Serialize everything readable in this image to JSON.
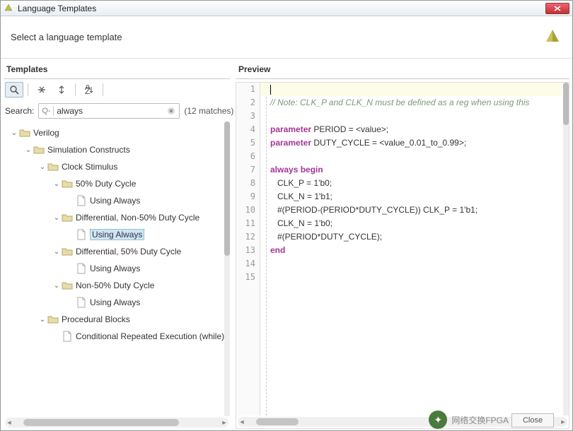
{
  "window": {
    "title": "Language Templates"
  },
  "subheader": {
    "text": "Select a language template"
  },
  "panes": {
    "templates_title": "Templates",
    "preview_title": "Preview"
  },
  "search": {
    "label": "Search:",
    "q_prefix": "Q-",
    "value": "always",
    "matches": "(12 matches)"
  },
  "tree": [
    {
      "indent": 0,
      "expanded": true,
      "kind": "folder",
      "label": "Verilog"
    },
    {
      "indent": 1,
      "expanded": true,
      "kind": "folder",
      "label": "Simulation Constructs"
    },
    {
      "indent": 2,
      "expanded": true,
      "kind": "folder",
      "label": "Clock Stimulus"
    },
    {
      "indent": 3,
      "expanded": true,
      "kind": "folder",
      "label": "50% Duty Cycle"
    },
    {
      "indent": 4,
      "expanded": null,
      "kind": "file",
      "label": "Using Always"
    },
    {
      "indent": 3,
      "expanded": true,
      "kind": "folder",
      "label": "Differential, Non-50% Duty Cycle"
    },
    {
      "indent": 4,
      "expanded": null,
      "kind": "file",
      "label": "Using Always",
      "selected": true
    },
    {
      "indent": 3,
      "expanded": true,
      "kind": "folder",
      "label": "Differential, 50% Duty Cycle"
    },
    {
      "indent": 4,
      "expanded": null,
      "kind": "file",
      "label": "Using Always"
    },
    {
      "indent": 3,
      "expanded": true,
      "kind": "folder",
      "label": "Non-50% Duty Cycle"
    },
    {
      "indent": 4,
      "expanded": null,
      "kind": "file",
      "label": "Using Always"
    },
    {
      "indent": 2,
      "expanded": true,
      "kind": "folder",
      "label": "Procedural Blocks"
    },
    {
      "indent": 3,
      "expanded": null,
      "kind": "file",
      "label": "Conditional Repeated Execution (while)"
    }
  ],
  "code": {
    "lines": [
      {
        "n": 1,
        "segs": [],
        "hl": true,
        "cursor": true
      },
      {
        "n": 2,
        "segs": [
          {
            "cls": "cmt",
            "t": "// Note: CLK_P and CLK_N must be defined as a reg when using this"
          }
        ]
      },
      {
        "n": 3,
        "segs": []
      },
      {
        "n": 4,
        "segs": [
          {
            "cls": "kw",
            "t": "parameter"
          },
          {
            "cls": "plain",
            "t": " PERIOD = <value>;"
          }
        ]
      },
      {
        "n": 5,
        "segs": [
          {
            "cls": "kw",
            "t": "parameter"
          },
          {
            "cls": "plain",
            "t": " DUTY_CYCLE = <value_0.01_to_0.99>;"
          }
        ]
      },
      {
        "n": 6,
        "segs": []
      },
      {
        "n": 7,
        "segs": [
          {
            "cls": "kw",
            "t": "always begin"
          }
        ]
      },
      {
        "n": 8,
        "segs": [
          {
            "cls": "plain",
            "t": "   CLK_P = 1'b0;"
          }
        ]
      },
      {
        "n": 9,
        "segs": [
          {
            "cls": "plain",
            "t": "   CLK_N = 1'b1;"
          }
        ]
      },
      {
        "n": 10,
        "segs": [
          {
            "cls": "plain",
            "t": "   #(PERIOD-(PERIOD*DUTY_CYCLE)) CLK_P = 1'b1;"
          }
        ]
      },
      {
        "n": 11,
        "segs": [
          {
            "cls": "plain",
            "t": "   CLK_N = 1'b0;"
          }
        ]
      },
      {
        "n": 12,
        "segs": [
          {
            "cls": "plain",
            "t": "   #(PERIOD*DUTY_CYCLE);"
          }
        ]
      },
      {
        "n": 13,
        "segs": [
          {
            "cls": "kw",
            "t": "end"
          }
        ]
      },
      {
        "n": 14,
        "segs": []
      },
      {
        "n": 15,
        "segs": []
      }
    ]
  },
  "dialog": {
    "close": "Close"
  },
  "watermark": {
    "text": "网络交换FPGA"
  }
}
